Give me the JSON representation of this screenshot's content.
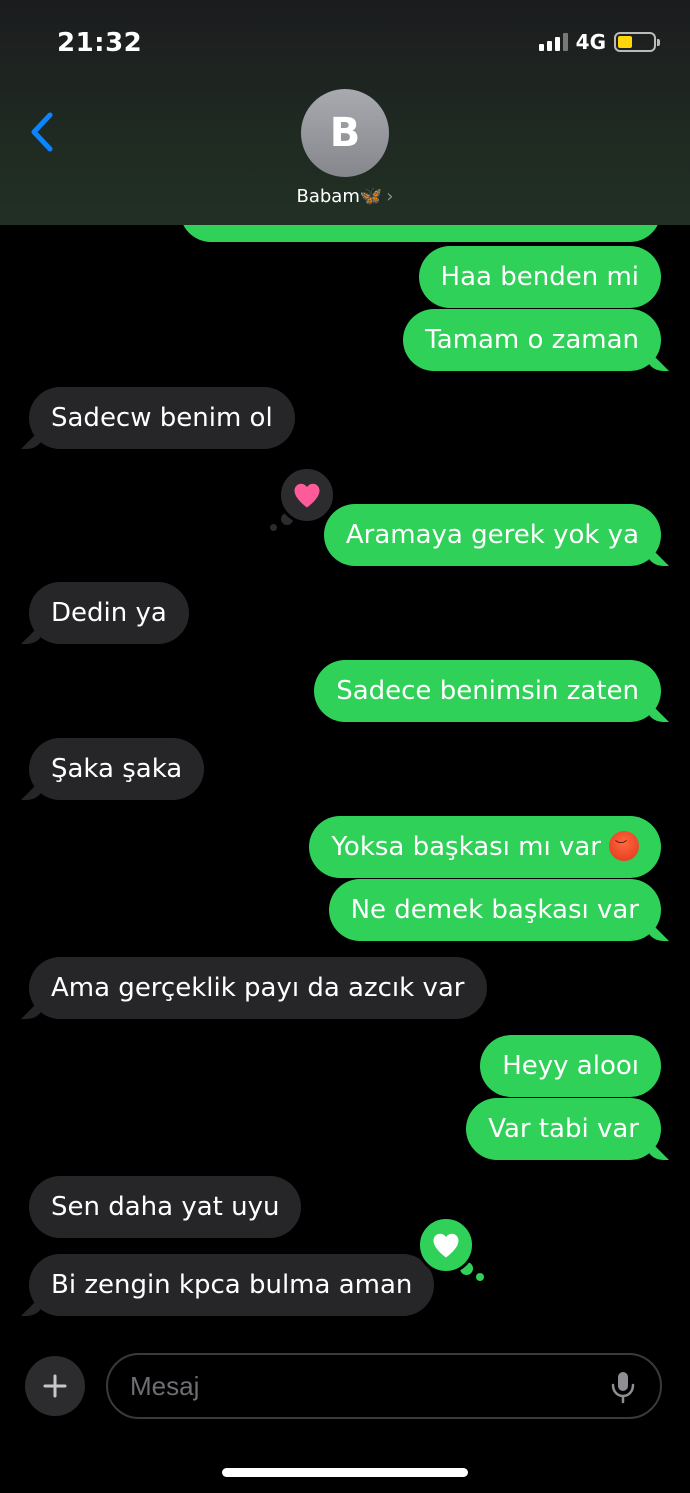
{
  "status_bar": {
    "time": "21:32",
    "network": "4G"
  },
  "header": {
    "avatar_initial": "B",
    "contact_name": "Babam🦋",
    "chevron": "›"
  },
  "messages": [
    {
      "direction": "outgoing",
      "text": "Haa benden mi"
    },
    {
      "direction": "outgoing",
      "text": "Tamam o zaman"
    },
    {
      "direction": "incoming",
      "text": "Sadecw benim ol"
    },
    {
      "direction": "outgoing",
      "text": "Aramaya gerek yok ya",
      "reaction": "heart"
    },
    {
      "direction": "incoming",
      "text": "Dedin ya"
    },
    {
      "direction": "outgoing",
      "text": "Sadece benimsin zaten"
    },
    {
      "direction": "incoming",
      "text": "Şaka şaka"
    },
    {
      "direction": "outgoing",
      "text": "Yoksa başkası mı var",
      "emoji": "angry-face"
    },
    {
      "direction": "outgoing",
      "text": "Ne demek başkası var"
    },
    {
      "direction": "incoming",
      "text": "Ama gerçeklik payı da azcık var"
    },
    {
      "direction": "outgoing",
      "text": "Heyy alooı"
    },
    {
      "direction": "outgoing",
      "text": "Var tabi var"
    },
    {
      "direction": "incoming",
      "text": "Sen daha yat uyu"
    },
    {
      "direction": "incoming",
      "text": "Bi zengin kpca bulma aman",
      "reaction": "heart"
    }
  ],
  "composer": {
    "placeholder": "Mesaj"
  },
  "colors": {
    "outgoing_bubble": "#30d158",
    "incoming_bubble": "#262628",
    "back_accent": "#0a84ff",
    "heart_pink": "#ff5a9a"
  }
}
